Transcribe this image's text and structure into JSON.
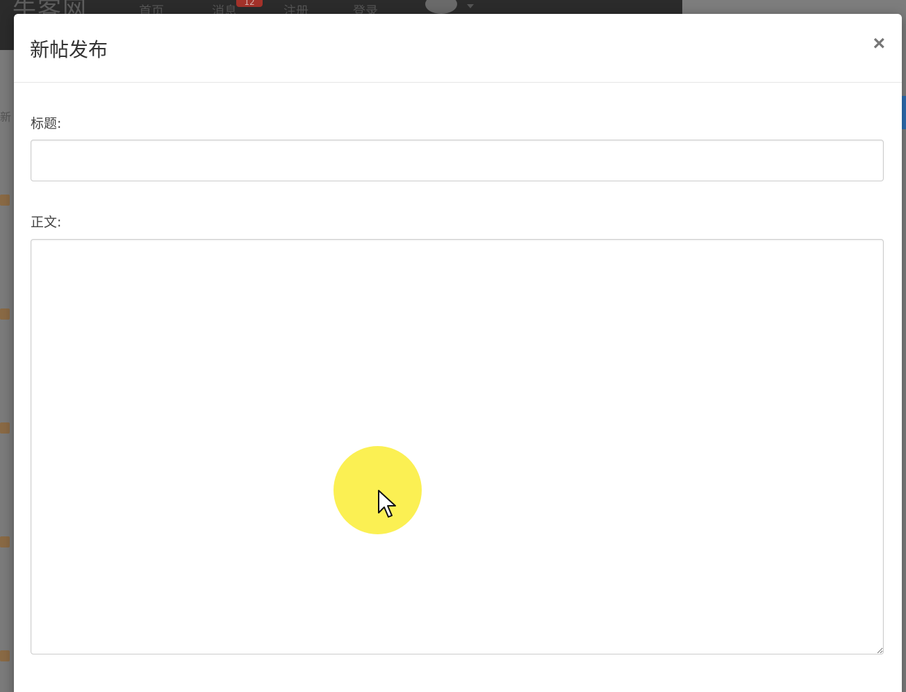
{
  "modal": {
    "title": "新帖发布",
    "close_label": "×",
    "fields": {
      "title_label": "标题:",
      "title_value": "",
      "body_label": "正文:",
      "body_value": ""
    }
  },
  "icons": {
    "close": "close-icon",
    "cursor": "mouse-pointer-icon"
  },
  "colors": {
    "overlay": "#8c8c8c",
    "modal_bg": "#ffffff",
    "cursor_highlight": "#fbef4a",
    "badge": "#a3322a"
  }
}
